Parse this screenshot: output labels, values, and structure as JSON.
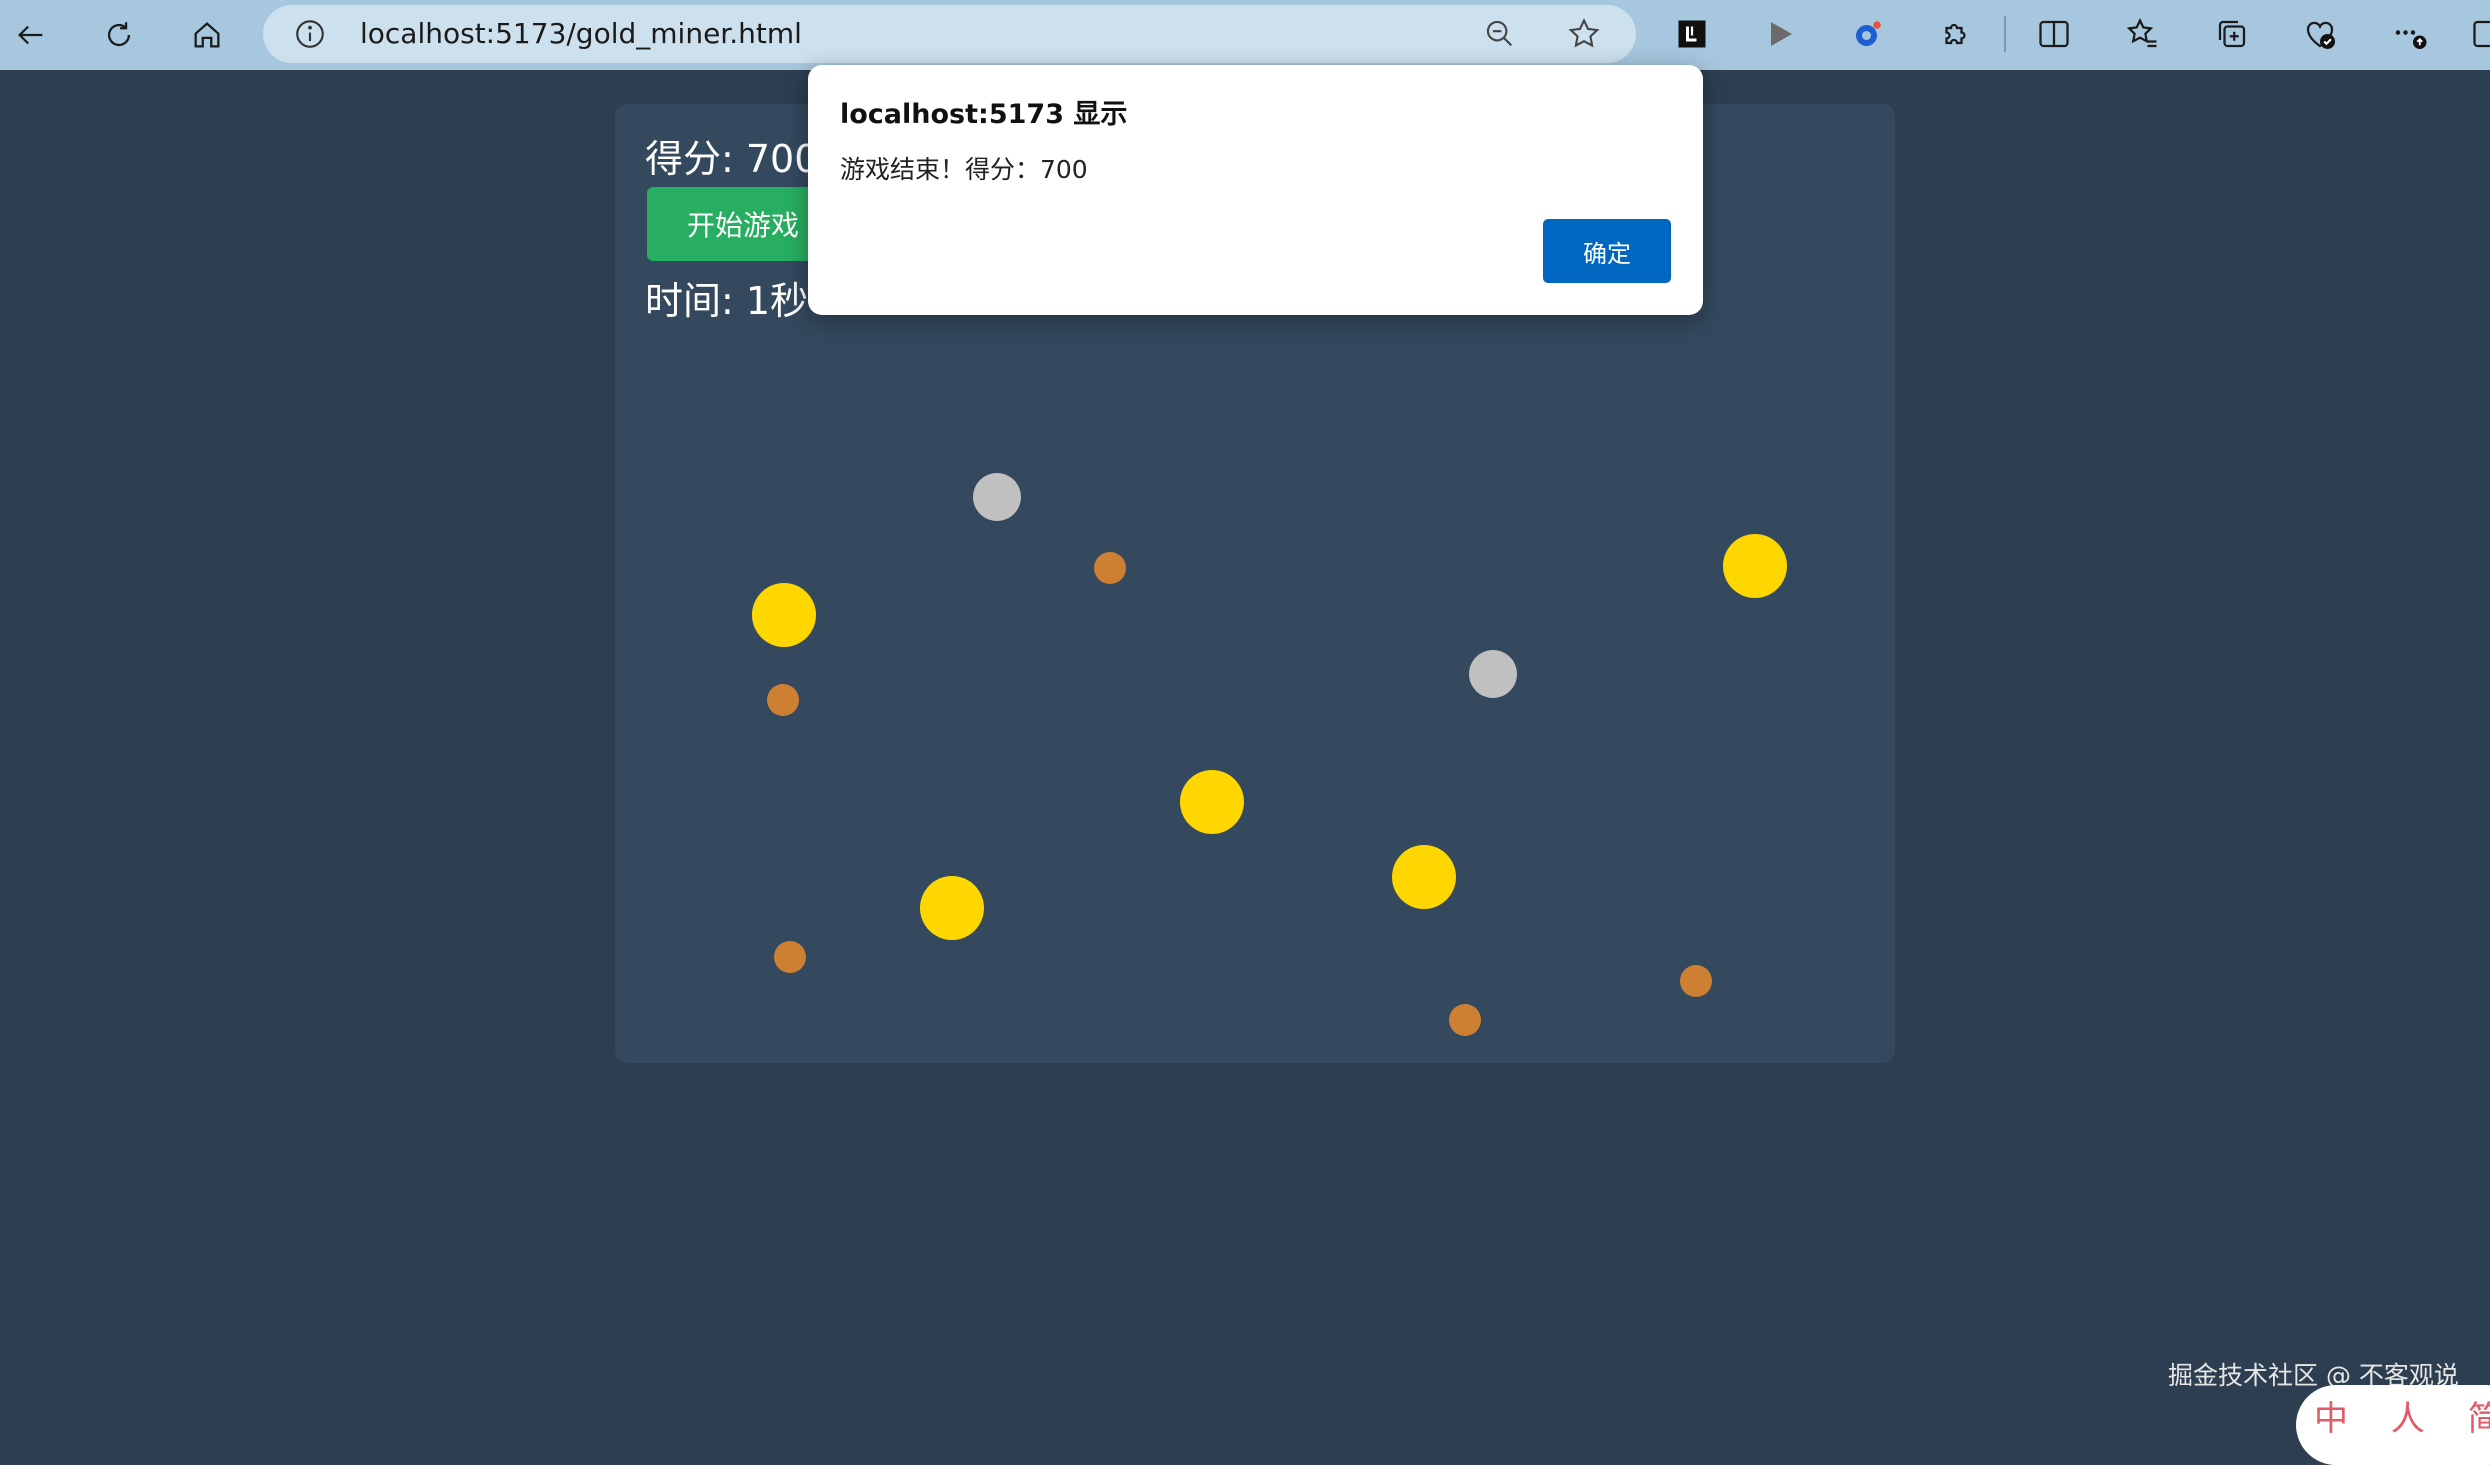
{
  "browser": {
    "url": "localhost:5173/gold_miner.html",
    "nav_icons": [
      "back-arrow-icon",
      "refresh-icon",
      "home-icon"
    ],
    "toolbar_icons": [
      "extension-l-icon",
      "play-icon",
      "copilot-icon",
      "extensions-puzzle-icon",
      "split-screen-icon",
      "favorites-icon",
      "collections-icon",
      "browser-essentials-icon",
      "more-options-icon"
    ]
  },
  "game": {
    "score_text": "得分: 700",
    "start_button_label": "开始游戏",
    "time_text": "时间: 1秒",
    "mineral_colors": {
      "gold": "#ffd700",
      "silver": "#c0c0c0",
      "copper": "#cd7f32"
    }
  },
  "alert": {
    "title": "localhost:5173 显示",
    "message": "游戏结束！得分：700",
    "ok_label": "确定"
  },
  "watermark": "掘金技术社区 @ 不客观说",
  "corner_widget_text": "中 人 简"
}
